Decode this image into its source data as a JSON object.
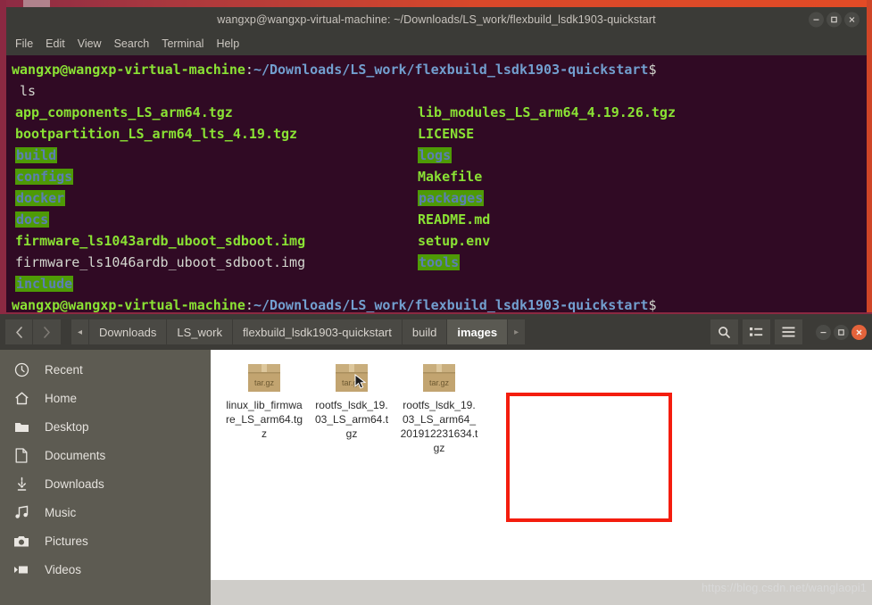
{
  "desktop": {
    "background_color": "#8b2942",
    "top_strip_color": "#d9482a"
  },
  "terminal": {
    "title": "wangxp@wangxp-virtual-machine: ~/Downloads/LS_work/flexbuild_lsdk1903-quickstart",
    "menu": [
      "File",
      "Edit",
      "View",
      "Search",
      "Terminal",
      "Help"
    ],
    "window_buttons": {
      "minimize": "minimize-icon",
      "maximize": "maximize-icon",
      "close": "close-icon"
    },
    "prompt": {
      "user_host": "wangxp@wangxp-virtual-machine",
      "separator": ":",
      "path": "~/Downloads/LS_work/flexbuild_lsdk1903-quickstart",
      "symbol": "$"
    },
    "command": "ls",
    "listing": {
      "column_left": [
        {
          "name": "app_components_LS_arm64.tgz",
          "type": "archive"
        },
        {
          "name": "bootpartition_LS_arm64_lts_4.19.tgz",
          "type": "archive"
        },
        {
          "name": "build",
          "type": "dir"
        },
        {
          "name": "configs",
          "type": "dir"
        },
        {
          "name": "docker",
          "type": "dir"
        },
        {
          "name": "docs",
          "type": "dir"
        },
        {
          "name": "firmware_ls1043ardb_uboot_sdboot.img",
          "type": "exec"
        },
        {
          "name": "firmware_ls1046ardb_uboot_sdboot.img",
          "type": "file"
        },
        {
          "name": "include",
          "type": "dir"
        }
      ],
      "column_right": [
        {
          "name": "lib_modules_LS_arm64_4.19.26.tgz",
          "type": "archive"
        },
        {
          "name": "LICENSE",
          "type": "file-green"
        },
        {
          "name": "logs",
          "type": "dir"
        },
        {
          "name": "Makefile",
          "type": "file-green"
        },
        {
          "name": "packages",
          "type": "dir"
        },
        {
          "name": "README.md",
          "type": "file-green"
        },
        {
          "name": "setup.env",
          "type": "file-green"
        },
        {
          "name": "tools",
          "type": "dir"
        }
      ]
    },
    "colors": {
      "background": "#300a24",
      "green": "#8ae234",
      "blue": "#729fcf",
      "dir_highlight": "#4e9a06"
    }
  },
  "file_manager": {
    "nav": {
      "back": "chevron-left-icon",
      "forward": "chevron-right-icon"
    },
    "breadcrumb": {
      "left_arrow": "◂",
      "items": [
        "Downloads",
        "LS_work",
        "flexbuild_lsdk1903-quickstart",
        "build",
        "images"
      ],
      "current": "images",
      "right_arrow": "▸"
    },
    "toolbar": {
      "search": "search-icon",
      "view_toggle": "list-view-icon",
      "menu": "hamburger-menu-icon"
    },
    "window_buttons": {
      "minimize": "minimize-icon",
      "maximize": "maximize-icon",
      "close": "close-icon"
    },
    "sidebar": [
      {
        "label": "Recent",
        "icon": "clock-icon"
      },
      {
        "label": "Home",
        "icon": "home-icon"
      },
      {
        "label": "Desktop",
        "icon": "folder-icon"
      },
      {
        "label": "Documents",
        "icon": "document-icon"
      },
      {
        "label": "Downloads",
        "icon": "download-icon"
      },
      {
        "label": "Music",
        "icon": "music-note-icon"
      },
      {
        "label": "Pictures",
        "icon": "camera-icon"
      },
      {
        "label": "Videos",
        "icon": "video-icon"
      }
    ],
    "files": [
      {
        "name": "linux_lib_firmware_LS_arm64.tgz",
        "icon_label": "tar.gz",
        "selected": false
      },
      {
        "name": "rootfs_lsdk_19.03_LS_arm64.tgz",
        "icon_label": "tar.gz",
        "selected": true
      },
      {
        "name": "rootfs_lsdk_19.03_LS_arm64_201912231634.tgz",
        "icon_label": "tar.gz",
        "selected": true
      }
    ],
    "highlight_box_color": "#f41d0e"
  },
  "watermark": "https://blog.csdn.net/wanglaopi1"
}
